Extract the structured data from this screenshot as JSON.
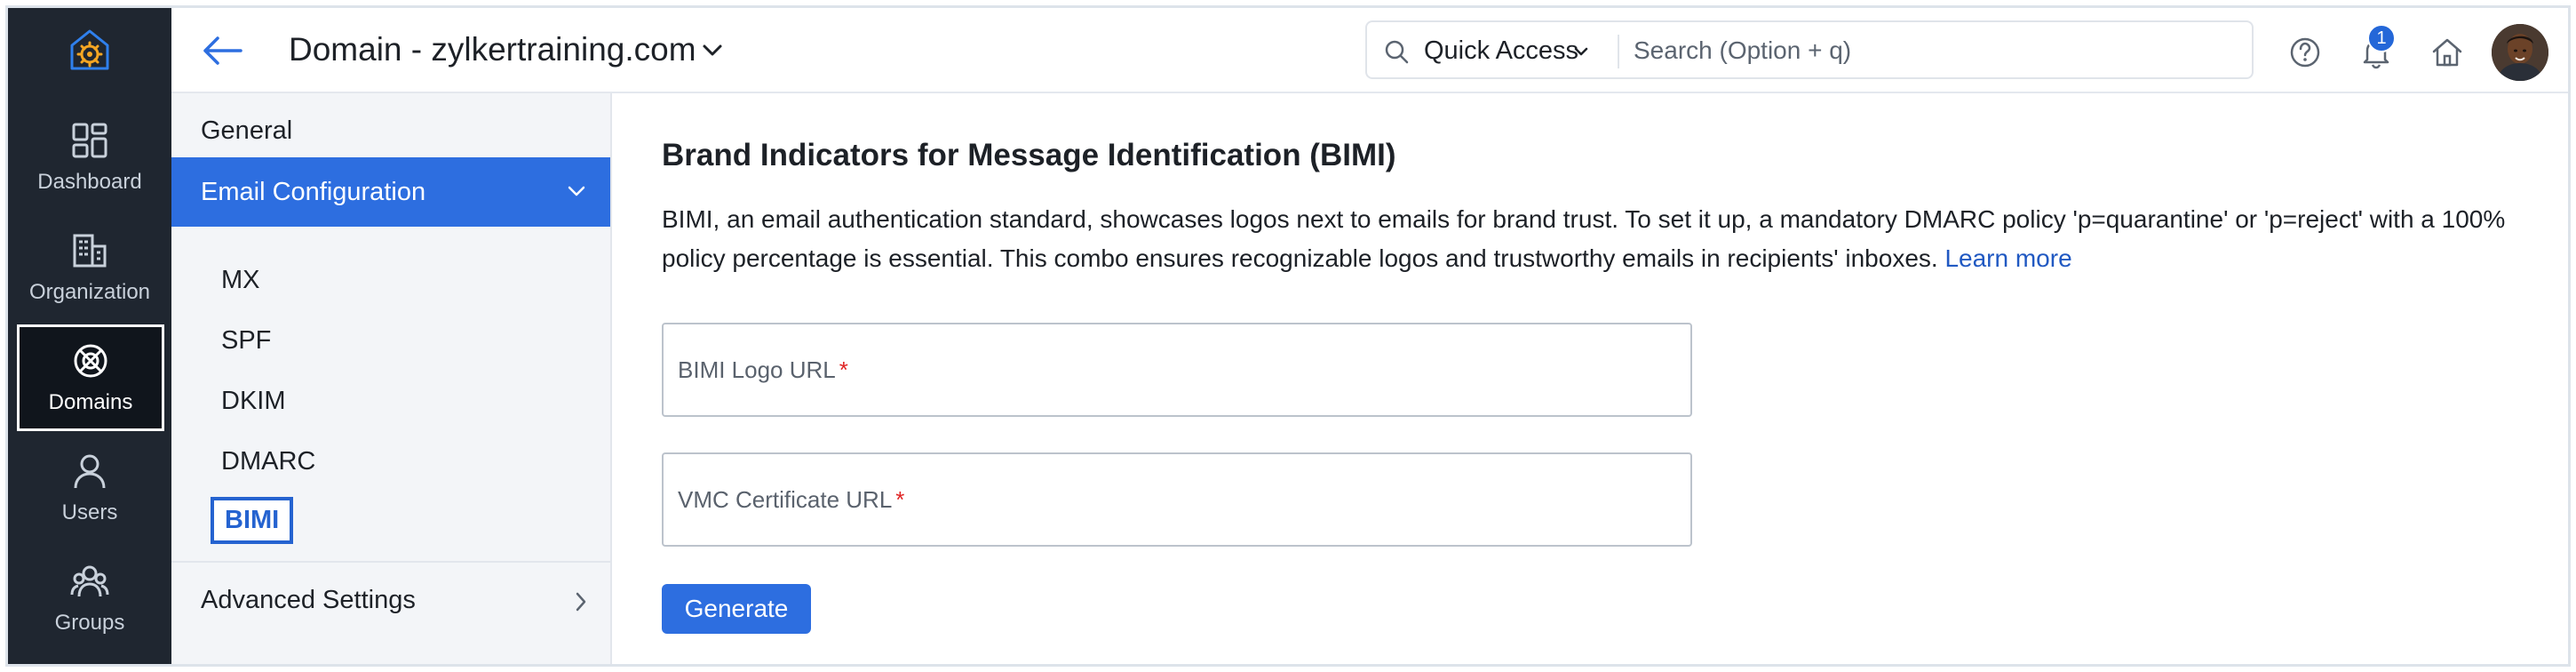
{
  "rail": {
    "items": [
      {
        "label": "Dashboard",
        "icon": "dashboard-icon"
      },
      {
        "label": "Organization",
        "icon": "organization-icon"
      },
      {
        "label": "Domains",
        "icon": "domains-icon"
      },
      {
        "label": "Users",
        "icon": "users-icon"
      },
      {
        "label": "Groups",
        "icon": "groups-icon"
      }
    ],
    "active": "Domains"
  },
  "header": {
    "title": "Domain - zylkertraining.com",
    "quick_access": "Quick Access",
    "search_placeholder": "Search (Option + q)",
    "notification_count": "1"
  },
  "subnav": {
    "general": "General",
    "section": "Email Configuration",
    "items": [
      "MX",
      "SPF",
      "DKIM",
      "DMARC",
      "BIMI"
    ],
    "active_item": "BIMI",
    "advanced": "Advanced Settings"
  },
  "main": {
    "title": "Brand Indicators for Message Identification (BIMI)",
    "description": "BIMI, an email authentication standard, showcases logos next to emails for brand trust. To set it up, a mandatory DMARC policy 'p=quarantine' or 'p=reject' with a 100% policy percentage is essential. This combo ensures recognizable logos and trustworthy emails in recipients' inboxes.",
    "learn_more": "Learn more",
    "fields": [
      {
        "label": "BIMI Logo URL",
        "required": true,
        "value": ""
      },
      {
        "label": "VMC Certificate URL",
        "required": true,
        "value": ""
      }
    ],
    "generate_label": "Generate"
  },
  "colors": {
    "rail_bg": "#1f2630",
    "accent": "#2d6ee0",
    "link": "#2159c2"
  }
}
